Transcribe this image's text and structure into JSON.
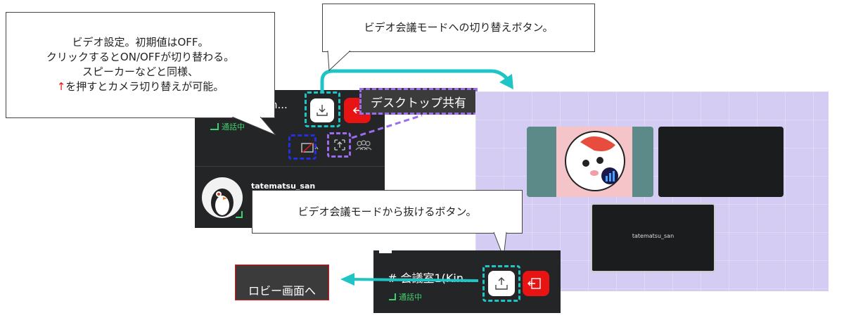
{
  "callouts": {
    "video_settings": [
      "ビデオ設定。初期値はOFF。",
      "クリックするとON/OFFが切り替わる。",
      "スピーカーなどと同様、",
      "↑を押すとカメラ切り替えが可能。"
    ],
    "switch_mode": "ビデオ会議モードへの切り替えボタン。",
    "exit_mode": "ビデオ会議モードから抜けるボタン。"
  },
  "labels": {
    "desktop_share": "デスクトップ共有",
    "back_to_lobby": "ロビー画面へ\n戻る"
  },
  "top_panel": {
    "room_title_partial": "n...",
    "status": "通話中",
    "user_name": "tatematsu_san"
  },
  "bottom_panel": {
    "room_title": "# 会議室1(Kin...",
    "status": "通話中"
  },
  "video_grid": {
    "tile_name": "tatematsu_san"
  },
  "colors": {
    "teal": "#1fc4c4",
    "purple_dash": "#9b6cf0",
    "blue_dash": "#2430e0",
    "red": "#e81414",
    "status_green": "#3fd16d"
  }
}
